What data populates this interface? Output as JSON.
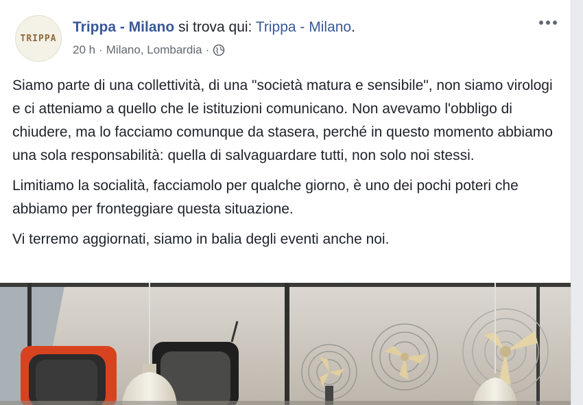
{
  "post": {
    "avatar_text": "TRIPPA",
    "author": "Trippa - Milano",
    "checkin_text": " si trova qui: ",
    "location_link": "Trippa - Milano",
    "period": ".",
    "time": "20 h",
    "sep1": " · ",
    "place": "Milano, Lombardia",
    "sep2": " · ",
    "privacy_icon": "globe-icon",
    "menu_icon": "more-options-icon",
    "paragraphs": [
      "Siamo parte di una collettività, di una \"società matura e sensibile\", non siamo virologi e ci atteniamo a quello che le istituzioni comunicano. Non avevamo l'obbligo di chiudere, ma lo facciamo comunque da stasera, perché in questo momento abbiamo una sola responsabilità: quella di salvaguardare tutti, non solo noi stessi.",
      "Limitiamo la socialità, facciamolo per qualche giorno, è uno dei pochi poteri che abbiamo per fronteggiare questa situazione.",
      "Vi terremo aggiornati, siamo in balia degli eventi anche noi."
    ]
  },
  "colors": {
    "link": "#385898",
    "text": "#1d2129",
    "meta": "#616770",
    "tv_orange": "#d8431f"
  }
}
